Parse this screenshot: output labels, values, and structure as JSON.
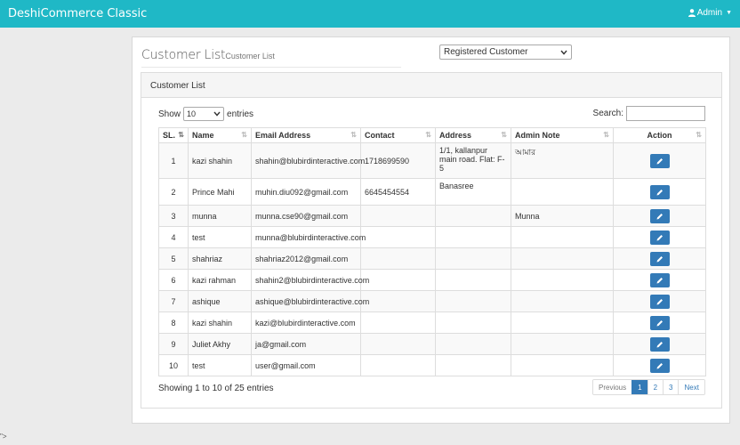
{
  "app": {
    "brand": "DeshiCommerce Classic",
    "user_label": "Admin"
  },
  "header": {
    "title": "Customer List",
    "subtitle": "Customer List"
  },
  "customer_type": {
    "selected": "Registered Customer"
  },
  "box": {
    "title": "Customer List"
  },
  "length": {
    "prefix": "Show",
    "value": "10",
    "suffix": "entries"
  },
  "search": {
    "label": "Search:",
    "value": ""
  },
  "table": {
    "columns": [
      "SL.",
      "Name",
      "Email Address",
      "Contact",
      "Address",
      "Admin Note",
      "Action"
    ],
    "rows": [
      [
        "1",
        "kazi shahin",
        "shahin@blubirdinteractive.com",
        "1718699590",
        "1/1, kallanpur main road. Flat: F-5",
        "আমার"
      ],
      [
        "2",
        "Prince Mahi",
        "muhin.diu092@gmail.com",
        "6645454554",
        "Banasree",
        ""
      ],
      [
        "3",
        "munna",
        "munna.cse90@gmail.com",
        "",
        "",
        "Munna"
      ],
      [
        "4",
        "test",
        "munna@blubirdinteractive.com",
        "",
        "",
        ""
      ],
      [
        "5",
        "shahriaz",
        "shahriaz2012@gmail.com",
        "",
        "",
        ""
      ],
      [
        "6",
        "kazi rahman",
        "shahin2@blubirdinteractive.com",
        "",
        "",
        ""
      ],
      [
        "7",
        "ashique",
        "ashique@blubirdinteractive.com",
        "",
        "",
        ""
      ],
      [
        "8",
        "kazi shahin",
        "kazi@blubirdinteractive.com",
        "",
        "",
        ""
      ],
      [
        "9",
        "Juliet Akhy",
        "ja@gmail.com",
        "",
        "",
        ""
      ],
      [
        "10",
        "test",
        "user@gmail.com",
        "",
        "",
        ""
      ]
    ]
  },
  "footer": {
    "info": "Showing 1 to 10 of 25 entries"
  },
  "pagination": {
    "previous": "Previous",
    "pages": [
      "1",
      "2",
      "3"
    ],
    "current": "1",
    "next": "Next"
  },
  "stray_text": "\">",
  "icons": {
    "user": "user-icon",
    "edit": "pencil-icon",
    "sort": "sort-icon"
  },
  "colors": {
    "topbar": "#1fb8c6",
    "primary": "#337ab7"
  }
}
